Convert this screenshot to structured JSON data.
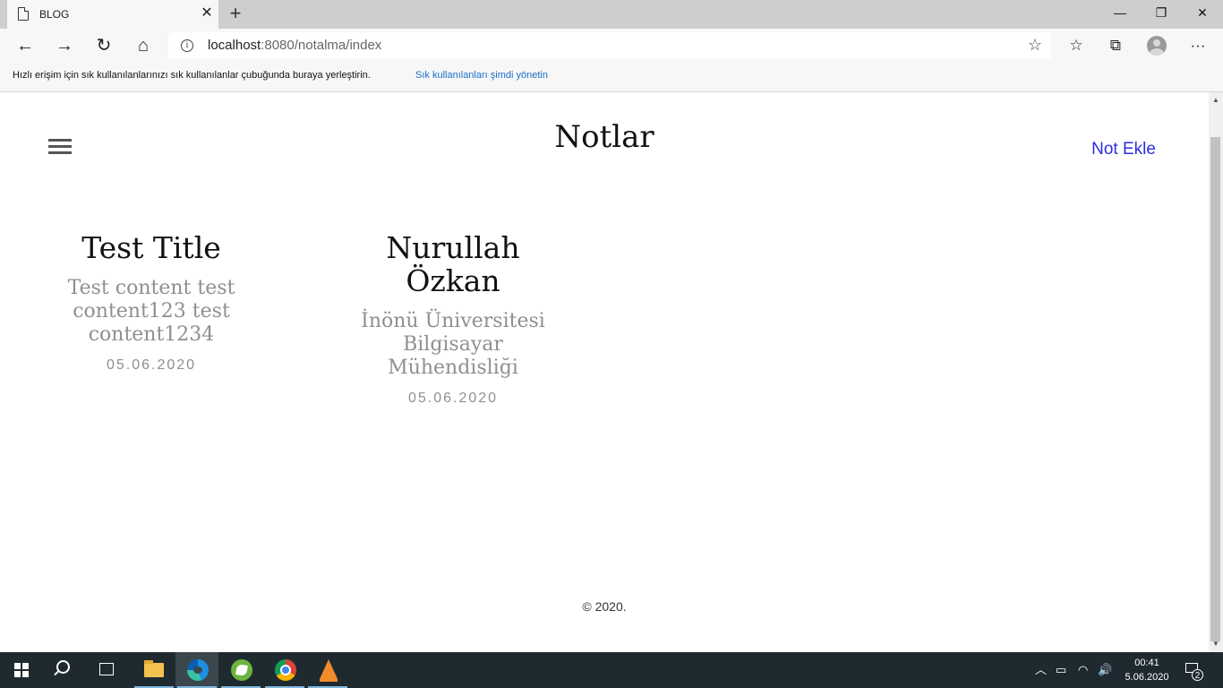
{
  "browser": {
    "tab_title": "BLOG",
    "tab_close": "✕",
    "new_tab": "+",
    "window_buttons": {
      "minimize": "—",
      "restore": "❐",
      "close": "✕"
    },
    "url_host": "localhost",
    "url_path": ":8080/notalma/index",
    "info": "i",
    "nav_icons": {
      "back": "←",
      "forward": "→",
      "refresh": "↻",
      "home": "⌂"
    },
    "star": "☆",
    "toolbar_icons": {
      "favorites": "☆",
      "collections": "⧉",
      "more": "···"
    },
    "favorites_bar_text": "Hızlı erişim için sık kullanılanlarınızı sık kullanılanlar çubuğunda buraya yerleştirin.",
    "favorites_bar_link": "Sık kullanılanları şimdi yönetin"
  },
  "page": {
    "title": "Notlar",
    "add_note": "Not Ekle",
    "posts": [
      {
        "title": "Test Title",
        "content": "Test content test content123 test content1234",
        "date": "05.06.2020"
      },
      {
        "title": "Nurullah Özkan",
        "content": "İnönü Üniversitesi Bilgisayar Mühendisliği",
        "date": "05.06.2020"
      }
    ],
    "footer": "© 2020."
  },
  "scrollbar": {
    "up": "▲",
    "down": "▼"
  },
  "taskbar": {
    "apps": [
      "start",
      "search",
      "task-view",
      "file-explorer",
      "edge",
      "spring-tool-suite",
      "chrome",
      "vlc"
    ],
    "active_app": "edge",
    "tray": {
      "chevron": "︿",
      "battery": "▭",
      "wifi": "◠",
      "volume": "🔊"
    },
    "time": "00:41",
    "date": "5.06.2020",
    "notification_count": "2"
  }
}
